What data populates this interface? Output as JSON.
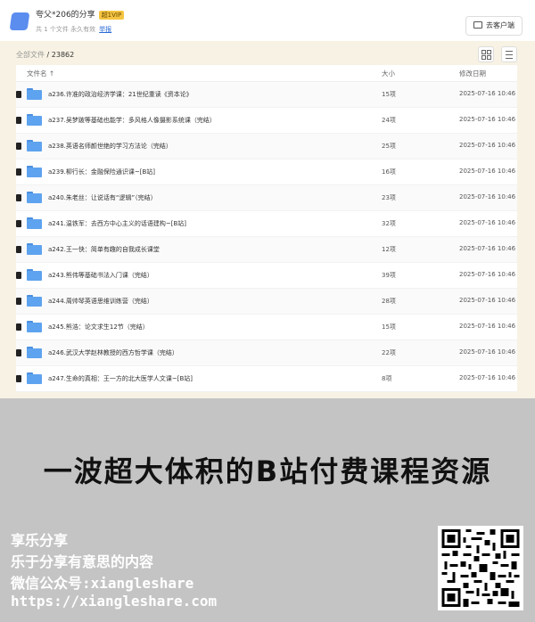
{
  "share": {
    "title": "夸父*206的分享",
    "badge": "超1VIP",
    "meta": "共 1 个文件  永久有效",
    "report": "举报",
    "client_button": "去客户端"
  },
  "breadcrumb": {
    "root": "全部文件",
    "separator": " / ",
    "current": "23862"
  },
  "table": {
    "headers": {
      "name": "文件名 ↑",
      "size": "大小",
      "date": "修改日期"
    },
    "rows": [
      {
        "name": "a236.许准的政治经济学课：21世纪重读《资本论》",
        "size": "15项",
        "date": "2025-07-16 10:46"
      },
      {
        "name": "a237.吴梦跛等基础也能学：多风格人像摄影系统课（完结）",
        "size": "24项",
        "date": "2025-07-16 10:46"
      },
      {
        "name": "a238.英语名师颜世绝的学习方法论（完结）",
        "size": "25项",
        "date": "2025-07-16 10:46"
      },
      {
        "name": "a239.柳行长：金融保险通识课~[B站]",
        "size": "16项",
        "date": "2025-07-16 10:46"
      },
      {
        "name": "a240.朱老丝：让说话有“逻辑”（完结）",
        "size": "23项",
        "date": "2025-07-16 10:46"
      },
      {
        "name": "a241.温铁军：去西方中心主义的话语建构~[B站]",
        "size": "32项",
        "date": "2025-07-16 10:46"
      },
      {
        "name": "a242.王一快：简单有趣的自我成长课堂",
        "size": "12项",
        "date": "2025-07-16 10:46"
      },
      {
        "name": "a243.熊伟等基础书法入门课（完结）",
        "size": "39项",
        "date": "2025-07-16 10:46"
      },
      {
        "name": "a244.周帅琴英语思维训练营（完结）",
        "size": "28项",
        "date": "2025-07-16 10:46"
      },
      {
        "name": "a245.熊浩：论文求生12节（完结）",
        "size": "15项",
        "date": "2025-07-16 10:46"
      },
      {
        "name": "a246.武汉大学赵林教授的西方哲学课（完结）",
        "size": "22项",
        "date": "2025-07-16 10:46"
      },
      {
        "name": "a247.生命的真相：王一方的北大医学人文课~[B站]",
        "size": "8项",
        "date": "2025-07-16 10:46"
      }
    ]
  },
  "promo": {
    "headline": "一波超大体积的B站付费课程资源",
    "line1": "享乐分享",
    "line2": "乐于分享有意思的内容",
    "line3": "微信公众号:xiangleshare",
    "line4": "https://xiangleshare.com"
  },
  "colors": {
    "folder_blue": "#5ea3ef",
    "link_blue": "#2a6ad6",
    "promo_bg": "#c4c4c4",
    "shot_bg": "#f7f2e3"
  }
}
